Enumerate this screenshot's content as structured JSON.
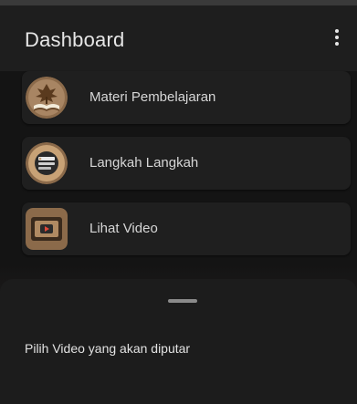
{
  "appbar": {
    "title": "Dashboard",
    "overflow_icon": "more-vert-icon"
  },
  "menu": {
    "items": [
      {
        "label": "Materi Pembelajaran",
        "icon": "book-tree-icon"
      },
      {
        "label": "Langkah Langkah",
        "icon": "steps-list-icon"
      },
      {
        "label": "Lihat Video",
        "icon": "video-play-icon"
      }
    ]
  },
  "bottom_sheet": {
    "message": "Pilih Video yang akan diputar"
  },
  "colors": {
    "background": "#121212",
    "card": "#1f1f1f",
    "icon_bg": "#8b6a4a",
    "text": "#d6d6d6"
  }
}
